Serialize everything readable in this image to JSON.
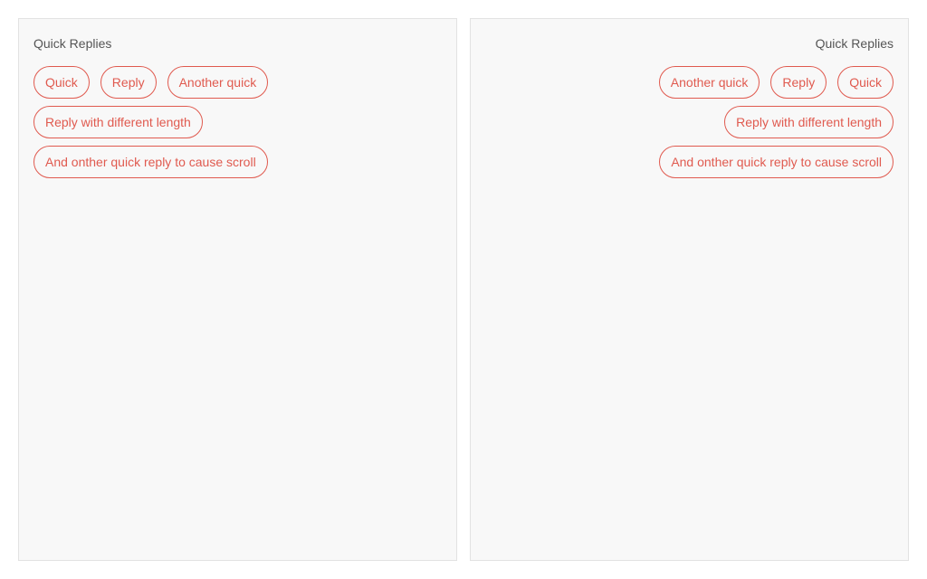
{
  "left_panel": {
    "title": "Quick Replies",
    "replies": [
      "Quick",
      "Reply",
      "Another quick",
      "Reply with different length",
      "And onther quick reply to cause scroll"
    ]
  },
  "right_panel": {
    "title": "Quick Replies",
    "replies": [
      "Another quick",
      "Reply",
      "Quick",
      "Reply with different length",
      "And onther quick reply to cause scroll"
    ]
  },
  "colors": {
    "accent": "#e05a4f",
    "panel_bg": "#f8f8f8",
    "panel_border": "#e2e2e2",
    "title_text": "#555555"
  }
}
